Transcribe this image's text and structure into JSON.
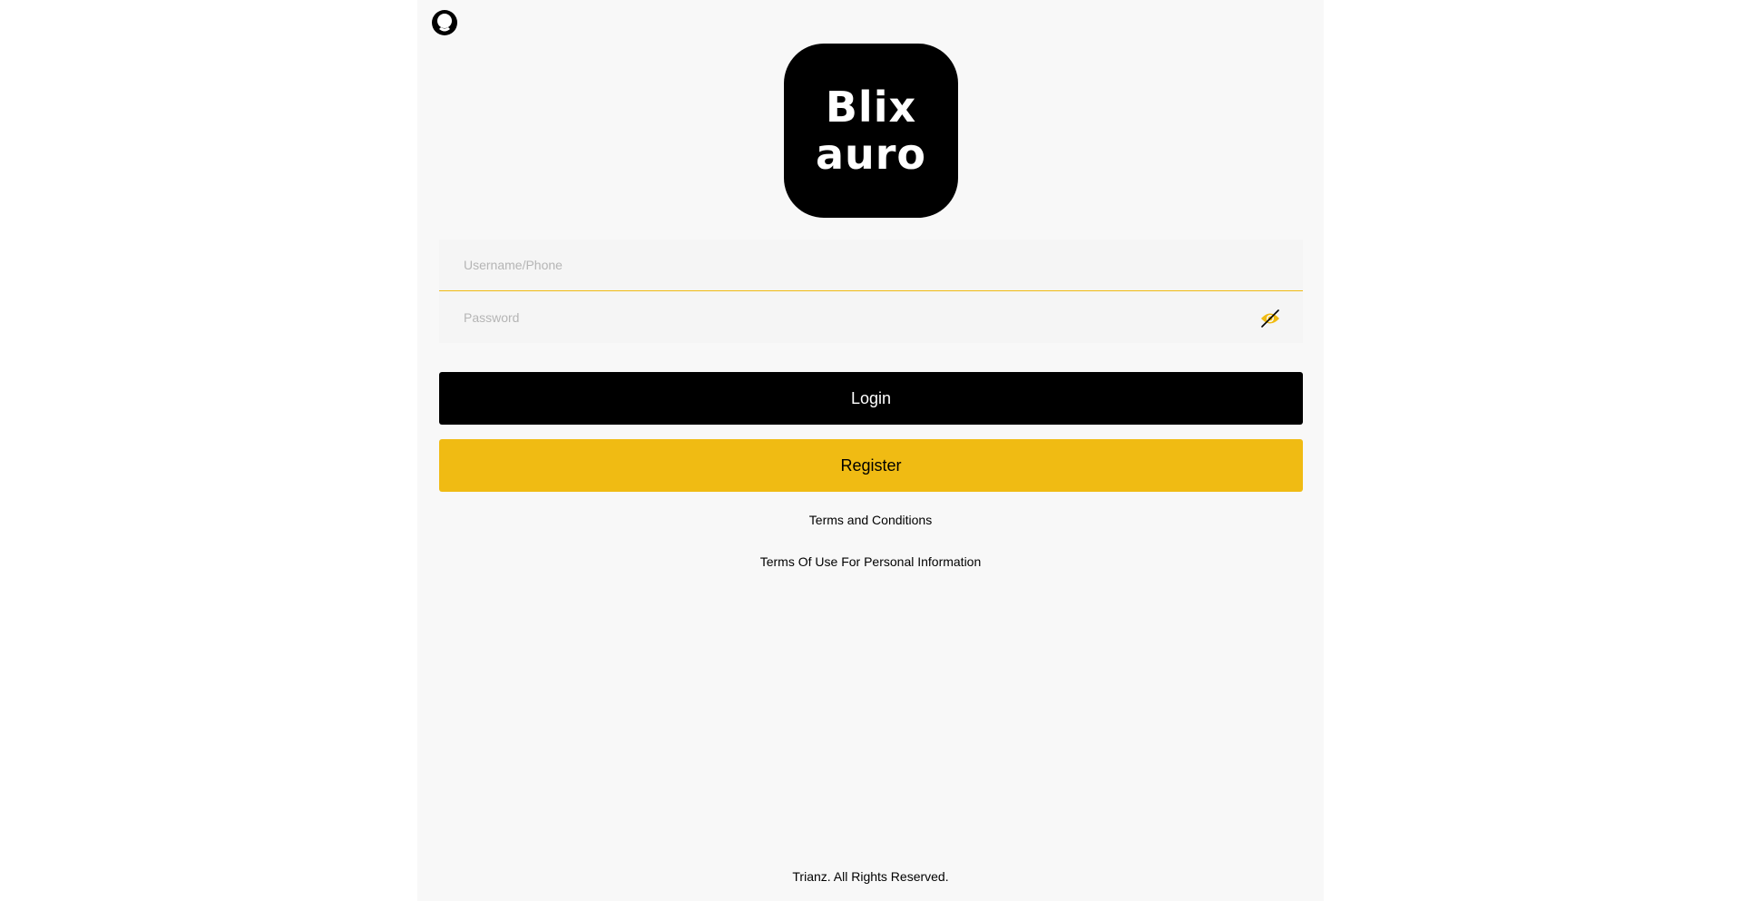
{
  "logo": {
    "line1": "Blix",
    "line2": "auro"
  },
  "login_form": {
    "username_placeholder": "Username/Phone",
    "username_value": "",
    "password_placeholder": "Password",
    "password_value": "",
    "password_toggle_icon": "eye-slash-icon"
  },
  "buttons": {
    "login_label": "Login",
    "register_label": "Register"
  },
  "links": {
    "terms": "Terms and Conditions",
    "personal_info": "Terms Of Use For Personal Information"
  },
  "footer": {
    "text": "Trianz. All Rights Reserved."
  },
  "colors": {
    "accent": "#f0bb13",
    "primary": "#000000",
    "background": "#f8f8f8"
  }
}
